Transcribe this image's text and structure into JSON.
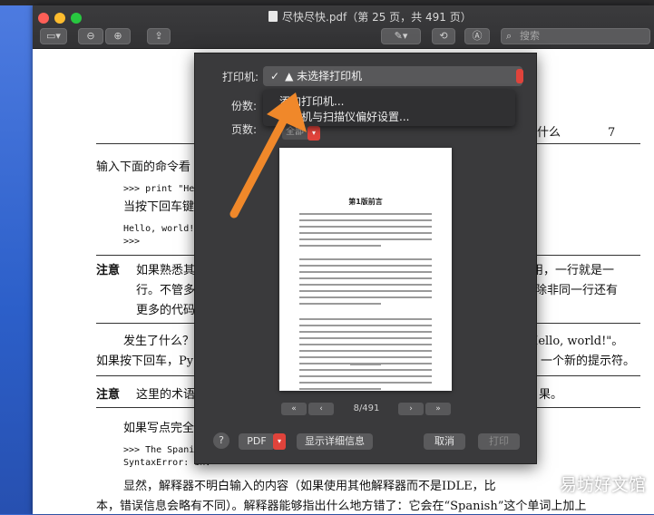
{
  "window": {
    "title": "尽快尽快.pdf（第 25 页，共 491 页）",
    "search_placeholder": "搜索"
  },
  "print_dialog": {
    "printer_label": "打印机:",
    "printer_value": "未选择打印机",
    "copies_label": "份数:",
    "pages_label": "页数:",
    "pages_value": "全部",
    "menu": {
      "add_printer": "添加打印机...",
      "printer_prefs": "打印机与扫描仪偏好设置..."
    },
    "preview_title": "第1版前言",
    "page_indicator": "8/491",
    "pdf_button": "PDF",
    "show_details": "显示详细信息",
    "cancel": "取消",
    "print": "打印"
  },
  "page": {
    "header_right": "么是什么",
    "page_number": "7",
    "lines": {
      "l1": "输入下面的命令看",
      "l2": ">>> print \"Hello",
      "l3": "当按下回车键",
      "l4": "Hello, world!",
      "l5": ">>>",
      "note1_label": "注意",
      "note1_a": "如果熟悉其",
      "note1_a_right": "用，一行就是一",
      "note1_b": "行。不管多",
      "note1_b_right": "除非同一行还有",
      "note1_c": "更多的代码",
      "q1": "发生了什么？",
      "q1_right": "\"Hello, world!\"。",
      "q2": "如果按下回车，Py",
      "q2_right": "一个新的提示符。",
      "note2_label": "注意",
      "note2": "这里的术语",
      "note2_right": "果。",
      "l6": "如果写点完全",
      "l7": ">>> The Spanish",
      "l8": "SyntaxError: inv",
      "l9": "显然，解释器不明白输入的内容（如果使用其他解释器而不是IDLE，比",
      "l10": "本，错误信息会略有不同）。解释器能够指出什么地方错了：它会在“Spanish”这个单词上加上"
    }
  },
  "watermark": "易坊好文馆"
}
